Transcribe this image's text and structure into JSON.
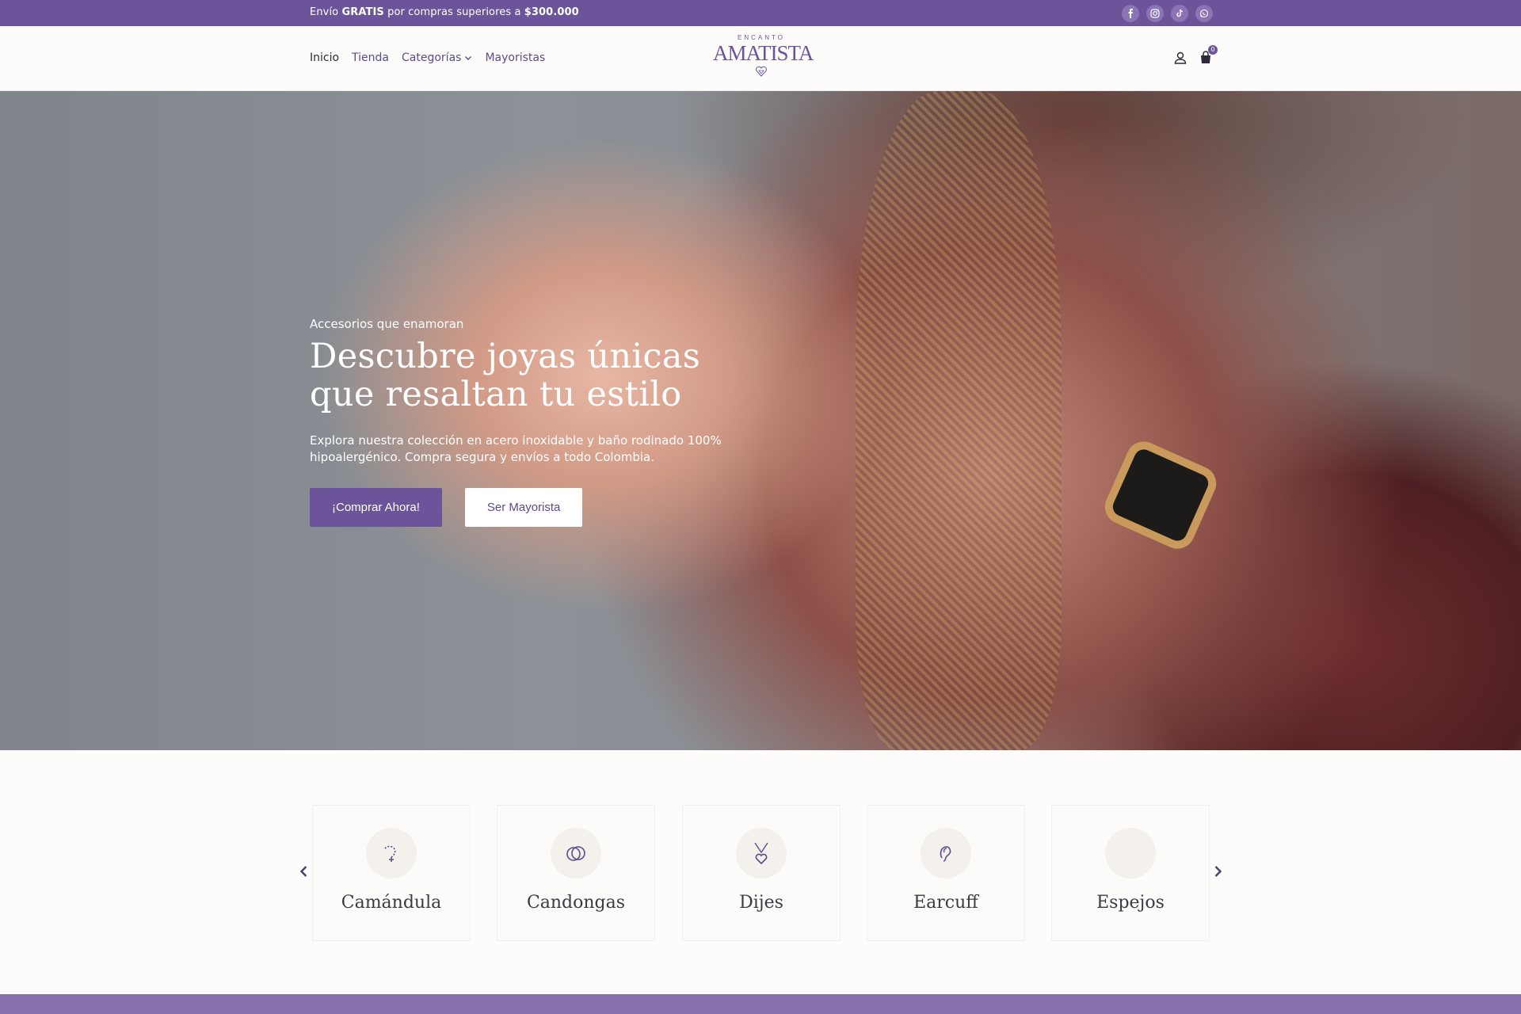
{
  "topbar": {
    "promo_prefix": "Envío",
    "promo_bold": "GRATIS",
    "promo_middle": "por compras superiores a",
    "promo_amount": "$300.000",
    "social_icons": [
      "facebook-icon",
      "instagram-icon",
      "tiktok-icon",
      "whatsapp-icon"
    ]
  },
  "nav": {
    "items": [
      "Inicio",
      "Tienda",
      "Categorías",
      "Mayoristas"
    ]
  },
  "logo": {
    "small": "ENCANTO",
    "big": "AMATISTA"
  },
  "cart": {
    "count": "0"
  },
  "hero": {
    "kicker": "Accesorios que enamoran",
    "title_line1": "Descubre joyas únicas",
    "title_line2": "que resaltan tu estilo",
    "description": "Explora nuestra colección en acero inoxidable y baño rodinado 100% hipoalergénico. Compra segura y envíos a todo Colombia.",
    "primary_button": "¡Comprar Ahora!",
    "secondary_button": "Ser Mayorista"
  },
  "categories": [
    {
      "name": "Camándula",
      "icon": "rosary-icon"
    },
    {
      "name": "Candongas",
      "icon": "hoop-earrings-icon"
    },
    {
      "name": "Dijes",
      "icon": "heart-pendant-icon"
    },
    {
      "name": "Earcuff",
      "icon": "ear-cuff-icon"
    },
    {
      "name": "Espejos",
      "icon": "mirror-icon"
    }
  ],
  "colors": {
    "brand_purple": "#6b5499",
    "accent_light_purple": "#8671ad",
    "background": "#fdfcfb"
  }
}
